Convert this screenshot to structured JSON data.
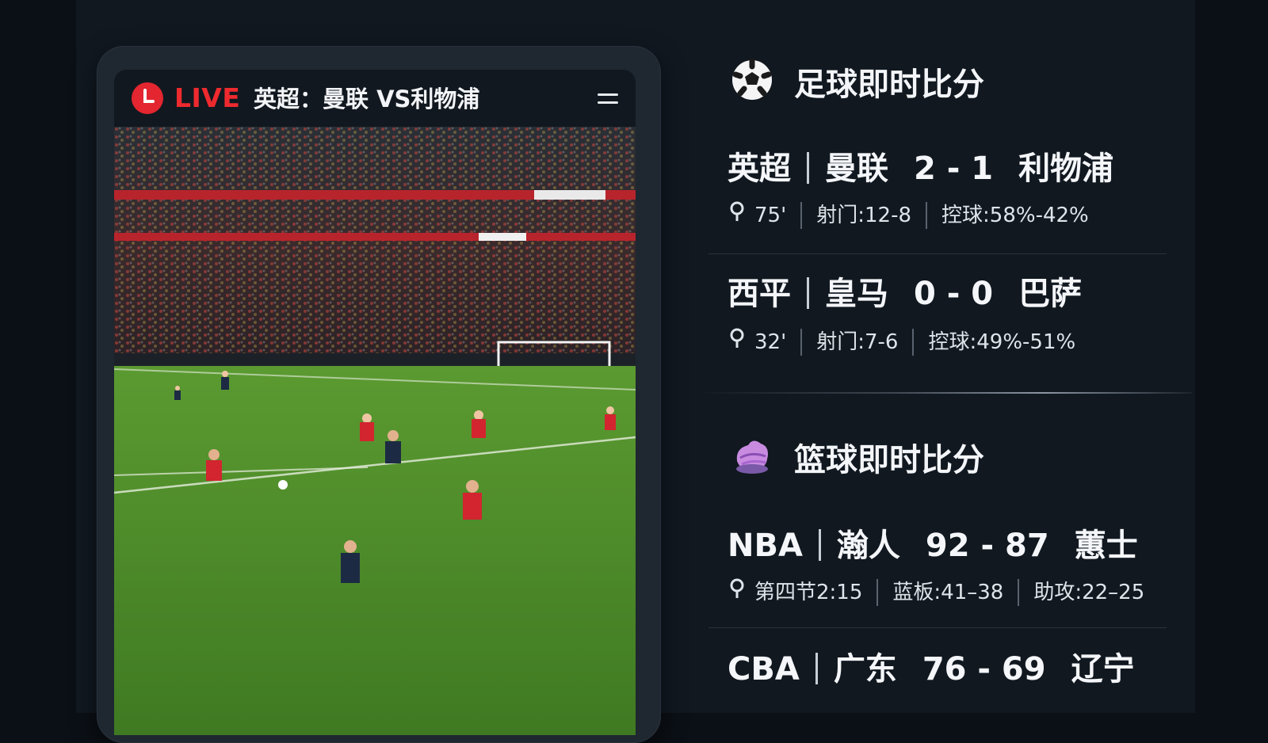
{
  "live": {
    "badge": "LIVE",
    "match_title": "英超：曼联 VS利物浦"
  },
  "football": {
    "title": "足球即时比分",
    "icon": "soccer-ball-icon",
    "matches": [
      {
        "league": "英超",
        "home": "曼联",
        "score": "2 - 1",
        "away": "利物浦",
        "minute": "75'",
        "shots": "射门:12-8",
        "possession": "控球:58%-42%"
      },
      {
        "league": "西平",
        "home": "皇马",
        "score": "0 - 0",
        "away": "巴萨",
        "minute": "32'",
        "shots": "射门:7-6",
        "possession": "控球:49%-51%"
      }
    ]
  },
  "basketball": {
    "title": "篮球即时比分",
    "icon": "basketball-icon",
    "matches": [
      {
        "league": "NBA",
        "home": "瀚人",
        "score": "92 - 87",
        "away": "蕙士",
        "period": "第四节2:15",
        "rebounds": "蓝板:41–38",
        "assists": "助攻:22–25"
      },
      {
        "league": "CBA",
        "home": "广东",
        "score": "76 - 69",
        "away": "辽宁"
      }
    ]
  },
  "colors": {
    "live_red": "#e3262f",
    "background": "#0b1016",
    "pitch_green": "#4f8a2a"
  }
}
